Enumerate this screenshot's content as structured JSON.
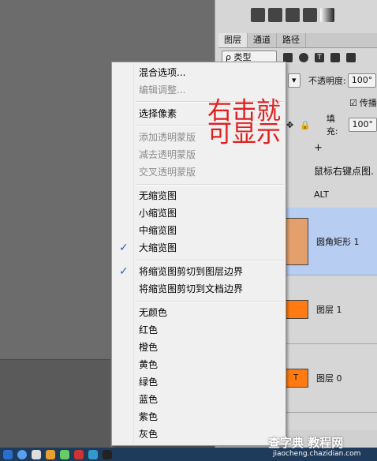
{
  "layers_panel": {
    "tabs": [
      "图层",
      "通道",
      "路径"
    ],
    "kind_filter": "ρ 类型",
    "opacity_label": "不透明度:",
    "opacity_value": "100°",
    "lock_label": "传播",
    "fill_label": "填充:",
    "fill_value": "100°",
    "plus_text": "+",
    "annotation_row": "鼠标右键点图.",
    "alt_text": "ALT",
    "layers": [
      {
        "name": "圆角矩形 1",
        "thumb_color": "#e3a06d",
        "selected": true
      },
      {
        "name": "图层 1",
        "thumb_color": "#ff7a10",
        "selected": false
      },
      {
        "name": "图层 0",
        "thumb_color": "#ff7a10",
        "thumb_text": "T",
        "selected": false
      }
    ]
  },
  "context_menu": {
    "items": [
      {
        "label": "混合选项...",
        "disabled": false
      },
      {
        "label": "编辑调整...",
        "disabled": true
      },
      {
        "label": "选择像素",
        "disabled": false
      },
      {
        "label": "添加透明蒙版",
        "disabled": true
      },
      {
        "label": "减去透明蒙版",
        "disabled": true
      },
      {
        "label": "交叉透明蒙版",
        "disabled": true
      },
      {
        "label": "无缩览图",
        "disabled": false
      },
      {
        "label": "小缩览图",
        "disabled": false
      },
      {
        "label": "中缩览图",
        "disabled": false
      },
      {
        "label": "大缩览图",
        "disabled": false,
        "checked": true
      },
      {
        "label": "将缩览图剪切到图层边界",
        "disabled": false,
        "checked": true
      },
      {
        "label": "将缩览图剪切到文档边界",
        "disabled": false
      },
      {
        "label": "无颜色",
        "disabled": false
      },
      {
        "label": "红色",
        "disabled": false
      },
      {
        "label": "橙色",
        "disabled": false
      },
      {
        "label": "黄色",
        "disabled": false
      },
      {
        "label": "绿色",
        "disabled": false
      },
      {
        "label": "蓝色",
        "disabled": false
      },
      {
        "label": "紫色",
        "disabled": false
      },
      {
        "label": "灰色",
        "disabled": false
      }
    ],
    "check_glyph": "✓"
  },
  "annotation": {
    "line1": "右击就",
    "line2": "可显示",
    "color": "#e02020"
  },
  "watermark": {
    "main": "查字典 教程网",
    "sub": "jiaocheng.chazidian.com"
  }
}
